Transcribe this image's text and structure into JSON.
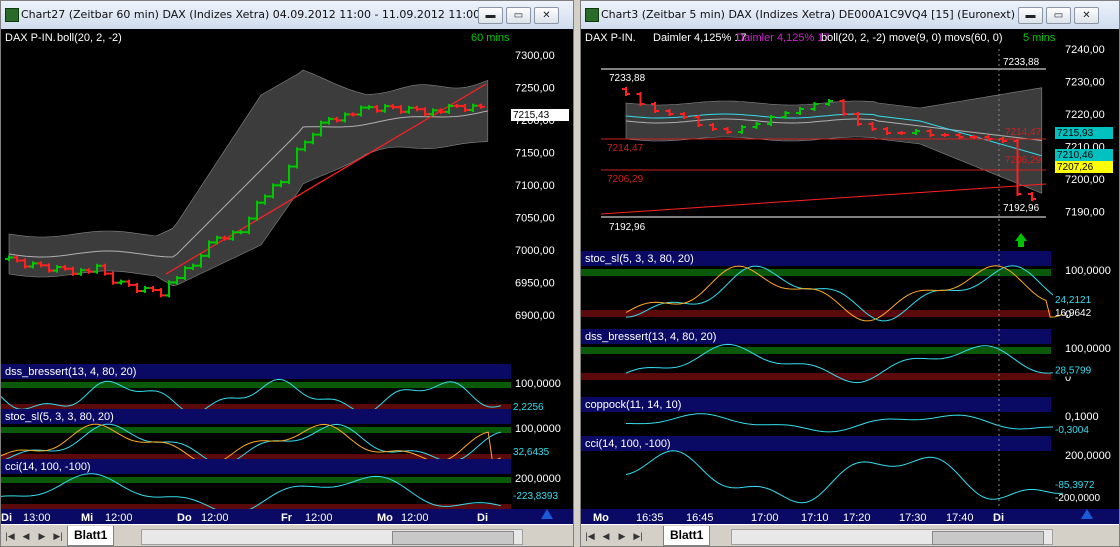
{
  "colors": {
    "up": "#00c800",
    "down": "#ff2020",
    "band": "#3c3c3c",
    "cyan": "#33ddee",
    "orange": "#ffaa22",
    "ma": "#b0b0b0",
    "trend": "#ff2020",
    "panelTitleBg": "#0a0a64",
    "greenZone": "#0a5a0a",
    "redZone": "#5a0a0a"
  },
  "left": {
    "title": "Chart27 (Zeitbar 60 min)  DAX (Indizes Xetra) 04.09.2012 11:00 - 11.09.2012 11:00",
    "legend": {
      "name": "DAX P-IN.",
      "ind": "boll(20, 2, -2)",
      "tf": "60 mins"
    },
    "price_ticks": [
      "7300,00",
      "7250,00",
      "7200,00",
      "7150,00",
      "7100,00",
      "7050,00",
      "7000,00",
      "6950,00",
      "6900,00"
    ],
    "last_price": "7215,43",
    "panels": [
      {
        "label": "dss_bressert(13, 4, 80, 20)",
        "ticks": [
          "100,0000",
          "0"
        ],
        "value": "2,2256"
      },
      {
        "label": "stoc_sl(5, 3, 3, 80, 20)",
        "ticks": [
          "100,0000",
          "0"
        ],
        "value": "32,6435"
      },
      {
        "label": "cci(14, 100, -100)",
        "ticks": [
          "200,0000"
        ],
        "value": "-223,8393"
      }
    ],
    "time_labels": [
      "Di",
      "13:00",
      "Mi",
      "12:00",
      "Do",
      "12:00",
      "Fr",
      "12:00",
      "Mo",
      "12:00",
      "Di"
    ],
    "tab": "Blatt1"
  },
  "right": {
    "title": "Chart3 (Zeitbar 5 min)  DAX (Indizes Xetra) DE000A1C9VQ4 [15] (Euronext)",
    "legend": {
      "name": "DAX P-IN.",
      "sym": "Daimler  4,125% 17",
      "sym2": "Daimler  4,125% 17",
      "ind": "boll(20, 2, -2) move(9, 0) movs(60, 0)",
      "tf": "5 mins"
    },
    "price_ticks": [
      "7240,00",
      "7230,00",
      "7220,00",
      "7210,00",
      "7200,00",
      "7190,00"
    ],
    "level_labels": {
      "hi": "7233,88",
      "hi2": "7233,88",
      "lo": "7192,96",
      "lo2": "7192,96",
      "r1": "7214,47",
      "r2": "7206,29",
      "r1b": "7214,47",
      "r2b": "7206,29"
    },
    "price_boxes": {
      "p1": "7215,93",
      "p2": "7210,46",
      "p3": "7207,26"
    },
    "panels": [
      {
        "label": "stoc_sl(5, 3, 3, 80, 20)",
        "ticks": [
          "100,0000",
          "0"
        ],
        "value": "24,2121",
        "value2": "16,9642"
      },
      {
        "label": "dss_bressert(13, 4, 80, 20)",
        "ticks": [
          "100,0000",
          "0"
        ],
        "value": "28,5799"
      },
      {
        "label": "coppock(11, 14, 10)",
        "ticks": [
          "0,1000"
        ],
        "value": "-0,3004"
      },
      {
        "label": "cci(14, 100, -100)",
        "ticks": [
          "200,0000"
        ],
        "value": "-85,3972",
        "value2": "-200,0000"
      }
    ],
    "time_labels": [
      "Mo",
      "16:35",
      "16:45",
      "17:00",
      "17:10",
      "17:20",
      "17:30",
      "17:40",
      "Di"
    ],
    "tab": "Blatt1"
  },
  "buttons": {
    "min": "▬",
    "max": "▭",
    "close": "✕"
  },
  "nav_glyphs": [
    "|◀",
    "◀",
    "▶",
    "▶|"
  ]
}
